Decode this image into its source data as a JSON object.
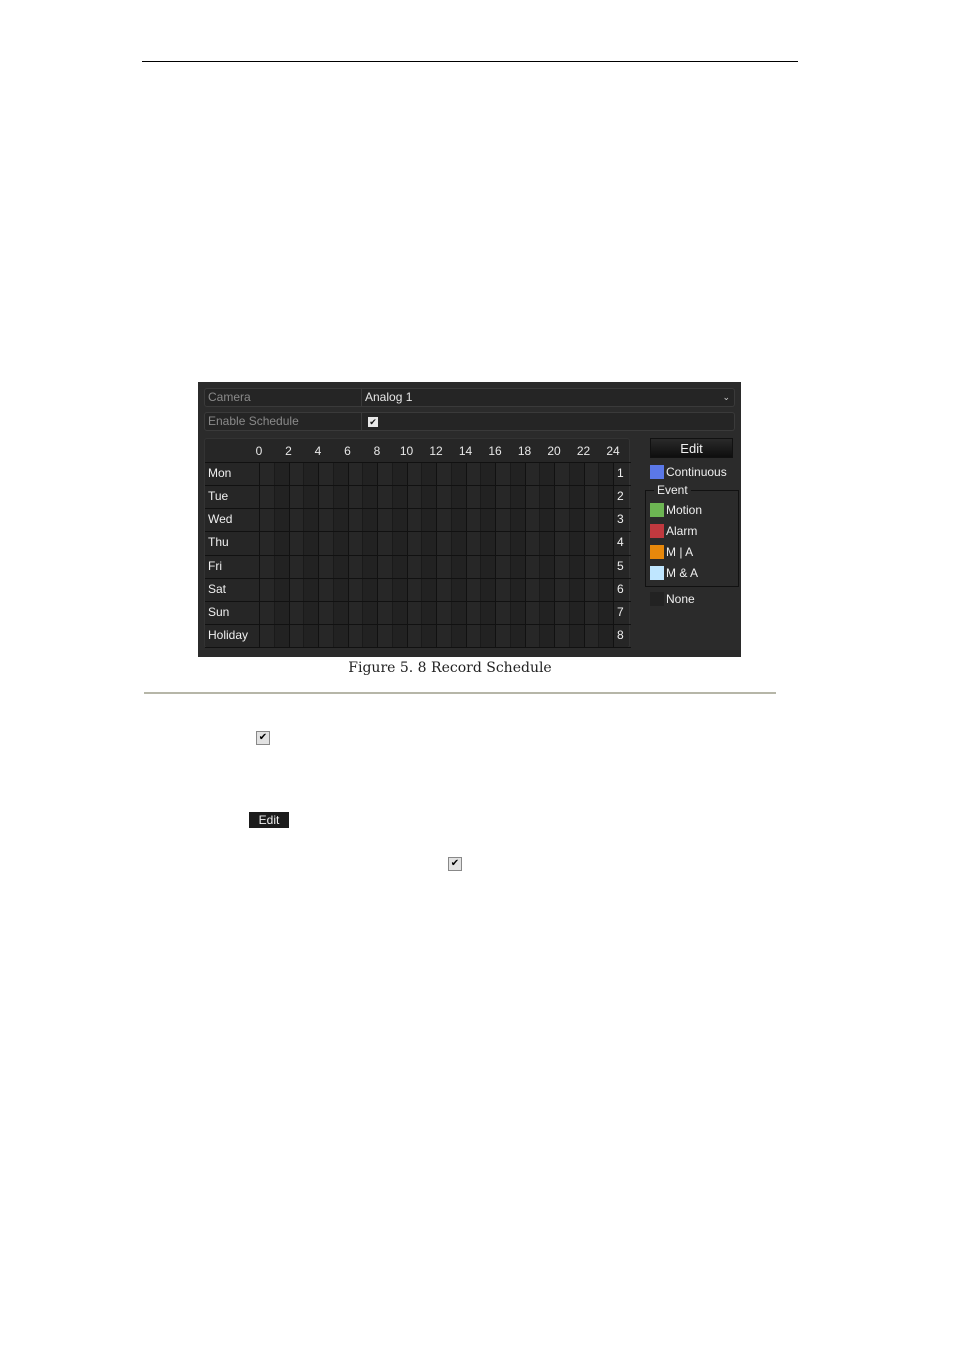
{
  "figure": {
    "caption": "Figure 5. 8 Record Schedule",
    "camera": {
      "label": "Camera",
      "value": "Analog 1",
      "dropdown_icon": "chevron-down-icon"
    },
    "enable_schedule": {
      "label": "Enable Schedule",
      "checked": true,
      "check_glyph": "✔"
    },
    "schedule": {
      "hours": [
        "0",
        "2",
        "4",
        "6",
        "8",
        "10",
        "12",
        "14",
        "16",
        "18",
        "20",
        "22",
        "24"
      ],
      "days": [
        "Mon",
        "Tue",
        "Wed",
        "Thu",
        "Fri",
        "Sat",
        "Sun",
        "Holiday"
      ],
      "row_numbers": [
        "1",
        "2",
        "3",
        "4",
        "5",
        "6",
        "7",
        "8"
      ]
    },
    "edit_label": "Edit",
    "legend": {
      "continuous": {
        "label": "Continuous",
        "color": "#5b78e8"
      },
      "event_title": "Event",
      "events": [
        {
          "label": "Motion",
          "color": "#6db553"
        },
        {
          "label": "Alarm",
          "color": "#c0393f"
        },
        {
          "label": "M | A",
          "color": "#e7880b"
        },
        {
          "label": "M & A",
          "color": "#bfe6ff"
        }
      ],
      "none": {
        "label": "None",
        "color": "#222222"
      }
    }
  },
  "body_icons": {
    "checkbox_glyph": "✔",
    "edit_label": "Edit"
  }
}
